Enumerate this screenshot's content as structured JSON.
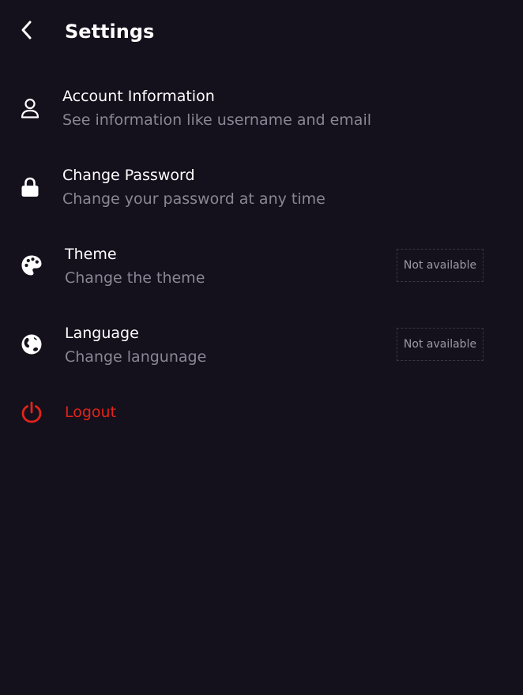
{
  "header": {
    "title": "Settings",
    "back_icon": "chevron-left-icon"
  },
  "items": [
    {
      "id": "account",
      "icon": "user-icon",
      "title": "Account Information",
      "subtitle": "See information like username and email"
    },
    {
      "id": "password",
      "icon": "lock-icon",
      "title": "Change Password",
      "subtitle": "Change your password at any time"
    },
    {
      "id": "theme",
      "icon": "palette-icon",
      "title": "Theme",
      "subtitle": "Change the theme",
      "badge": "Not available"
    },
    {
      "id": "language",
      "icon": "globe-icon",
      "title": "Language",
      "subtitle": "Change langunage",
      "badge": "Not available"
    }
  ],
  "logout": {
    "icon": "power-icon",
    "label": "Logout"
  },
  "colors": {
    "background": "#14111c",
    "text_primary": "#ffffff",
    "text_secondary": "#8a8795",
    "danger": "#e3231b",
    "badge_text": "#9c99a6",
    "badge_border": "#3a3646"
  }
}
